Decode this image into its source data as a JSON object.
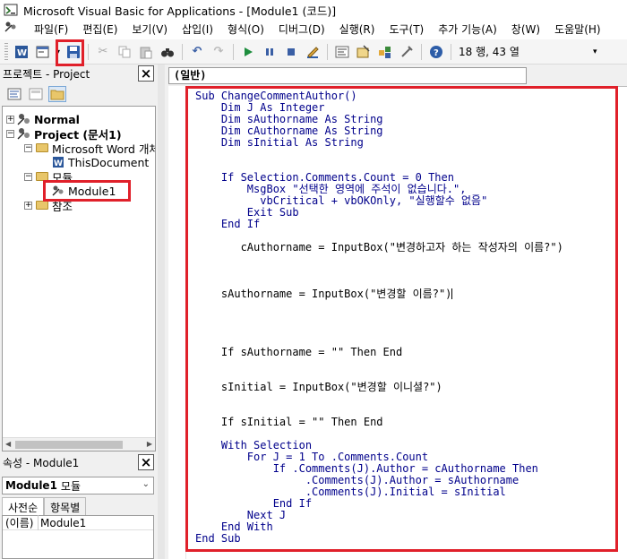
{
  "window": {
    "title": "Microsoft Visual Basic for Applications - [Module1 (코드)]"
  },
  "menu": [
    "파일(F)",
    "편집(E)",
    "보기(V)",
    "삽입(I)",
    "형식(O)",
    "디버그(D)",
    "실행(R)",
    "도구(T)",
    "추가 기능(A)",
    "창(W)",
    "도움말(H)"
  ],
  "toolbar": {
    "cursor_position": "18 행, 43 열"
  },
  "project_panel": {
    "title": "프로젝트 - Project",
    "tree": {
      "normal": "Normal",
      "project": "Project (문서1)",
      "word_objects": "Microsoft Word 개체",
      "this_document": "ThisDocument",
      "modules": "모듈",
      "module1": "Module1",
      "references": "참조"
    }
  },
  "properties_panel": {
    "title": "속성 - Module1",
    "object_name": "Module1",
    "object_type": "모듈",
    "tabs": [
      "사전순",
      "항목별"
    ],
    "row_name": "(이름)",
    "row_value": "Module1"
  },
  "code_window": {
    "object_combo": "(일반)",
    "code": {
      "l1": "Sub ChangeCommentAuthor()",
      "l2": "    Dim J As Integer",
      "l3": "    Dim sAuthorname As String",
      "l4": "    Dim cAuthorname As String",
      "l5": "    Dim sInitial As String",
      "l6": "    If Selection.Comments.Count = 0 Then",
      "l7": "        MsgBox \"선택한 영역에 주석이 없습니다.\", _",
      "l8": "          vbCritical + vbOKOnly, \"실행할수 없음\"",
      "l9": "        Exit Sub",
      "l10": "    End If",
      "l11": "       cAuthorname = InputBox(\"변경하고자 하는 작성자의 이름?\")",
      "l12": "    sAuthorname = InputBox(\"변경할 이름?\")",
      "l13": "    If sAuthorname = \"\" Then End",
      "l14": "    sInitial = InputBox(\"변경할 이니셜?\")",
      "l15": "    If sInitial = \"\" Then End",
      "l16": "    With Selection",
      "l17": "        For J = 1 To .Comments.Count",
      "l18": "            If .Comments(J).Author = cAuthorname Then",
      "l19": "                 .Comments(J).Author = sAuthorname",
      "l20": "                 .Comments(J).Initial = sInitial",
      "l21": "            End If",
      "l22": "        Next J",
      "l23": "    End With",
      "l24": "End Sub"
    }
  },
  "colors": {
    "highlight_red": "#e0202a",
    "keyword_blue": "#00008b"
  }
}
